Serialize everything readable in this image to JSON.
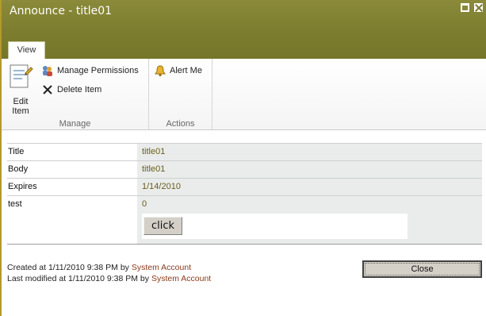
{
  "dialog": {
    "title": "Announce - title01"
  },
  "ribbon": {
    "tab": "View",
    "manage_group_label": "Manage",
    "actions_group_label": "Actions",
    "edit_item_line1": "Edit",
    "edit_item_line2": "Item",
    "manage_permissions": "Manage Permissions",
    "delete_item": "Delete Item",
    "alert_me": "Alert Me"
  },
  "fields": [
    {
      "label": "Title",
      "value": "title01"
    },
    {
      "label": "Body",
      "value": "title01"
    },
    {
      "label": "Expires",
      "value": "1/14/2010"
    },
    {
      "label": "test",
      "value": "0",
      "button": "click"
    }
  ],
  "footer": {
    "created_prefix": "Created at 1/11/2010 9:38 PM by",
    "created_by": "System Account",
    "modified_prefix": "Last modified at 1/11/2010 9:38 PM by",
    "modified_by": "System Account"
  },
  "close_label": "Close",
  "colors": {
    "title_bar": "#7d7d2f",
    "value_bg": "#e9ecea",
    "value_text": "#6b5d1e",
    "link": "#8a3a1a"
  }
}
